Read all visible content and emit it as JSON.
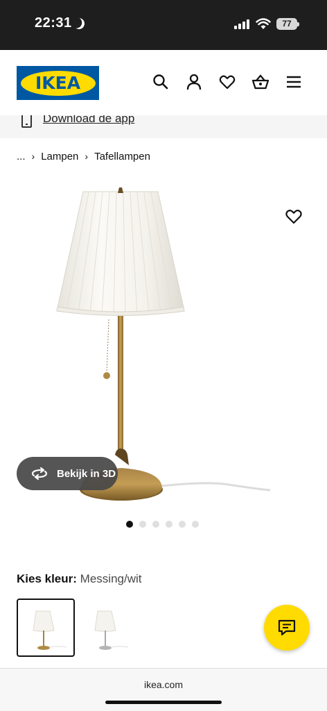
{
  "status_bar": {
    "time": "22:31",
    "battery": "77"
  },
  "header": {
    "logo_text": "IKEA",
    "icons": [
      "search-icon",
      "account-icon",
      "heart-icon",
      "basket-icon",
      "menu-icon"
    ]
  },
  "app_banner": {
    "link_text": "Download de app"
  },
  "breadcrumb": {
    "items": [
      "...",
      "Lampen",
      "Tafellampen"
    ]
  },
  "product": {
    "view_3d_label": "Bekijk in 3D",
    "image_count": 6,
    "active_image": 1
  },
  "color_select": {
    "label": "Kies kleur:",
    "value": "Messing/wit"
  },
  "browser": {
    "url": "ikea.com"
  },
  "colors": {
    "ikea_blue": "#0058a3",
    "ikea_yellow": "#ffdb00",
    "status_bar_bg": "#1e1e1e",
    "view3d_bg": "#484848"
  }
}
